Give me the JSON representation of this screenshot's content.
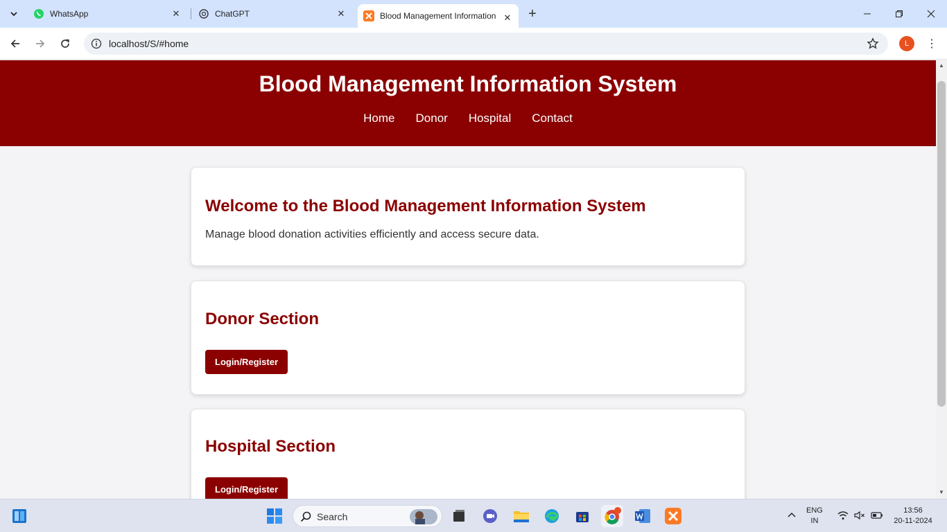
{
  "browser": {
    "tabs": [
      {
        "title": "WhatsApp"
      },
      {
        "title": "ChatGPT"
      },
      {
        "title": "Blood Management Information System"
      }
    ],
    "url": "localhost/S/#home",
    "profile_initial": "L"
  },
  "site": {
    "title": "Blood Management Information System",
    "nav": [
      "Home",
      "Donor",
      "Hospital",
      "Contact"
    ],
    "welcome": {
      "heading": "Welcome to the Blood Management Information System",
      "text": "Manage blood donation activities efficiently and access secure data."
    },
    "donor": {
      "heading": "Donor Section",
      "button": "Login/Register"
    },
    "hospital": {
      "heading": "Hospital Section",
      "button": "Login/Register"
    }
  },
  "taskbar": {
    "search_label": "Search",
    "lang": "ENG",
    "region": "IN",
    "time": "13:56",
    "date": "20-11-2024"
  },
  "colors": {
    "brand": "#8b0000"
  }
}
